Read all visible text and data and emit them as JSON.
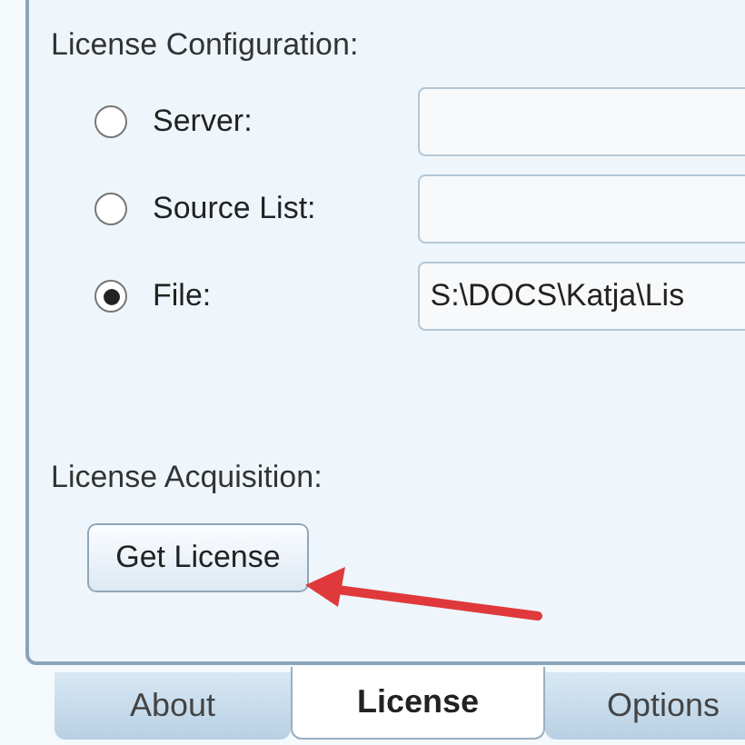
{
  "license_configuration": {
    "heading": "License Configuration:",
    "options": [
      {
        "label": "Server:",
        "selected": false
      },
      {
        "label": "Source List:",
        "selected": false
      },
      {
        "label": "File:",
        "selected": true,
        "value": "S:\\DOCS\\Katja\\Lis"
      }
    ]
  },
  "license_acquisition": {
    "heading": "License Acquisition:",
    "button": "Get License"
  },
  "tabs": [
    {
      "label": "About",
      "selected": false
    },
    {
      "label": "License",
      "selected": true
    },
    {
      "label": "Options",
      "selected": false
    }
  ]
}
